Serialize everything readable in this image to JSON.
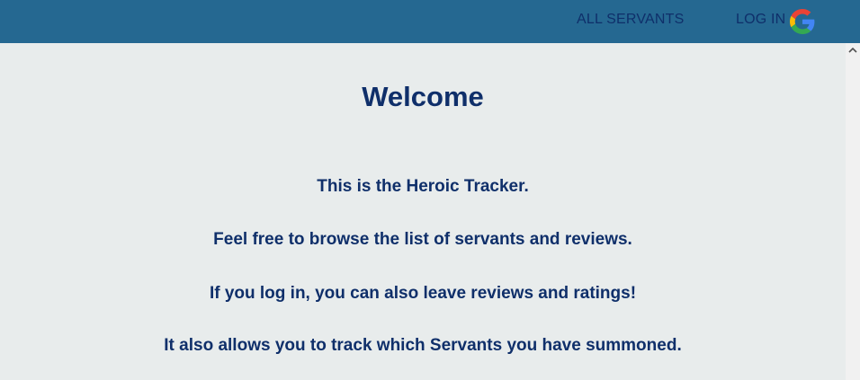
{
  "nav": {
    "all_servants_label": "ALL SERVANTS",
    "login_label": "LOG IN",
    "login_icon": "google-icon"
  },
  "main": {
    "title": "Welcome",
    "paragraphs": [
      "This is the Heroic Tracker.",
      "Feel free to browse the list of servants and reviews.",
      "If you log in, you can also leave reviews and ratings!",
      "It also allows you to track which Servants you have summoned."
    ]
  },
  "colors": {
    "header_bg": "#256891",
    "page_bg": "#e8ecec",
    "text": "#0f2f6a"
  }
}
